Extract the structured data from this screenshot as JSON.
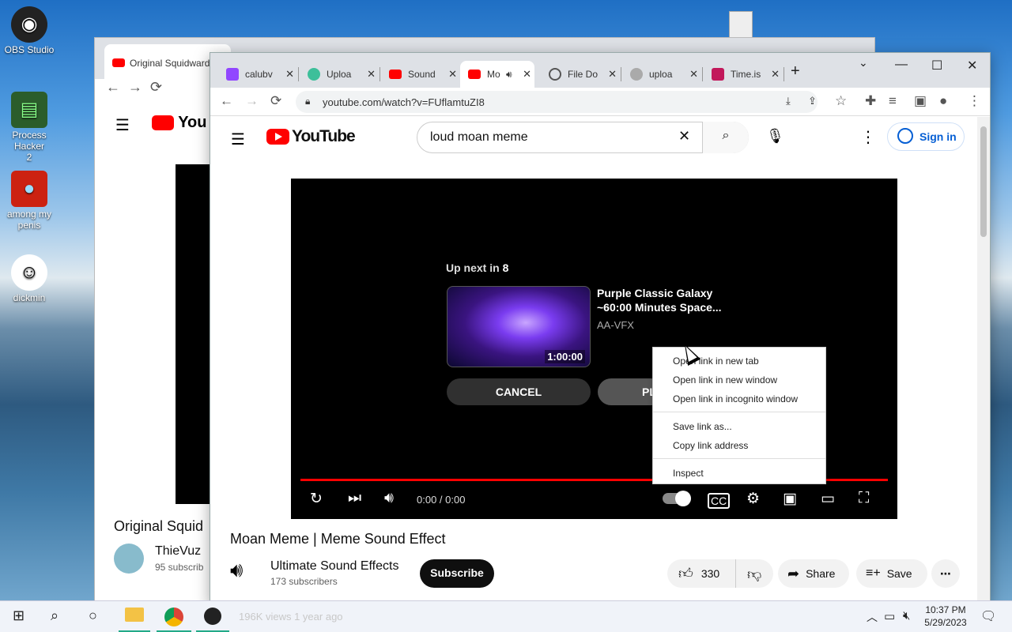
{
  "desktop": {
    "icons": [
      {
        "label": "OBS Studio"
      },
      {
        "label": "Process Hacker 2"
      },
      {
        "label": "among my penis"
      },
      {
        "label": "dickmin"
      }
    ]
  },
  "back_window": {
    "tab_title": "Original Squidward"
  },
  "tabs": [
    {
      "title": "calubv"
    },
    {
      "title": "Uploa"
    },
    {
      "title": "Sound"
    },
    {
      "title": "Mo"
    },
    {
      "title": "File Do"
    },
    {
      "title": "uploa"
    },
    {
      "title": "Time.is"
    }
  ],
  "address": "youtube.com/watch?v=FUflamtuZI8",
  "youtube": {
    "logo": "YouTube",
    "search_value": "loud moan meme",
    "sign_in": "Sign in",
    "upnext_label": "Up next in",
    "upnext_count": "8",
    "next_title": "Purple Classic Galaxy ~60:00 Minutes Space...",
    "next_channel": "AA-VFX",
    "next_duration": "1:00:00",
    "cancel": "CANCEL",
    "play_now": "PL",
    "time": "0:00 / 0:00",
    "video_title": "Moan Meme | Meme Sound Effect",
    "channel": "Ultimate Sound Effects",
    "subscribers": "173 subscribers",
    "subscribe": "Subscribe",
    "likes": "330",
    "share": "Share",
    "save": "Save",
    "views": "196K views  1 year ago"
  },
  "context_menu": [
    "Open link in new tab",
    "Open link in new window",
    "Open link in incognito window",
    "Save link as...",
    "Copy link address",
    "Inspect"
  ],
  "backpage": {
    "title": "Original Squid",
    "channel": "ThieVuz",
    "subs": "95 subscrib"
  },
  "taskbar": {
    "time": "10:37 PM",
    "date": "5/29/2023"
  }
}
